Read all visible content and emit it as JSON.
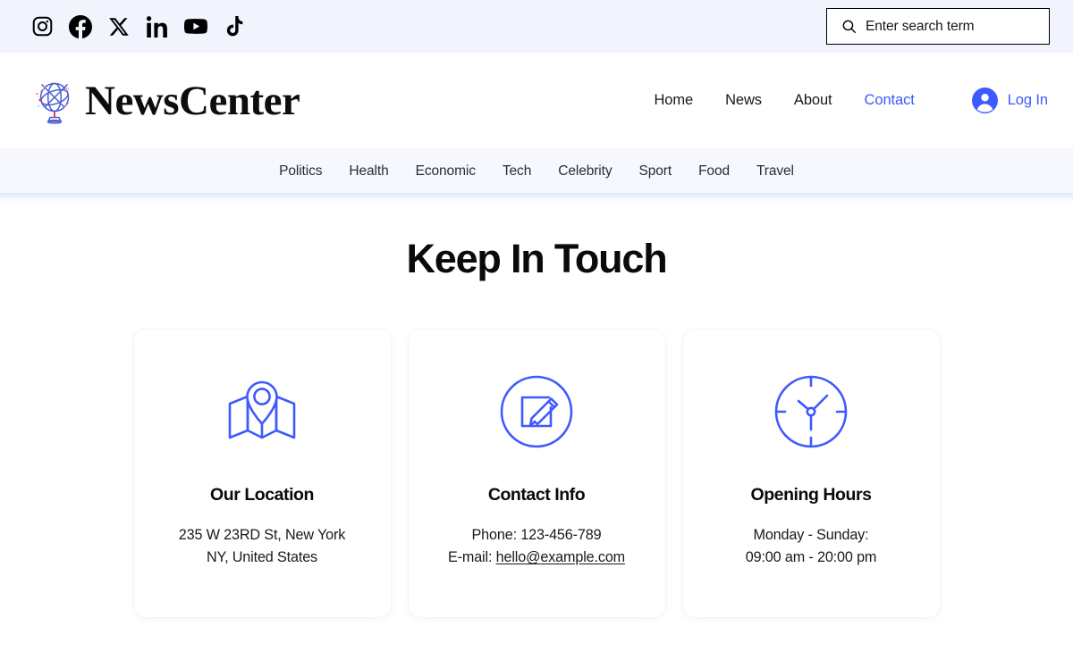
{
  "colors": {
    "accent": "#3d5afe",
    "topbar_bg": "#f1f3fd",
    "catbar_bg": "#f6f8fe",
    "text": "#0a0a0a",
    "page_bg": "#ffffff"
  },
  "topbar": {
    "social": [
      {
        "name": "instagram-icon",
        "label": "Instagram"
      },
      {
        "name": "facebook-icon",
        "label": "Facebook"
      },
      {
        "name": "x-twitter-icon",
        "label": "X"
      },
      {
        "name": "linkedin-icon",
        "label": "LinkedIn"
      },
      {
        "name": "youtube-icon",
        "label": "YouTube"
      },
      {
        "name": "tiktok-icon",
        "label": "TikTok"
      }
    ],
    "search": {
      "icon": "search-icon",
      "placeholder": "Enter search term",
      "value": ""
    }
  },
  "header": {
    "logo_icon": "globe-icon",
    "brand_name": "NewsCenter",
    "nav": [
      {
        "label": "Home",
        "active": false
      },
      {
        "label": "News",
        "active": false
      },
      {
        "label": "About",
        "active": false
      },
      {
        "label": "Contact",
        "active": true
      }
    ],
    "login": {
      "icon": "account-circle-icon",
      "label": "Log In"
    }
  },
  "categories": [
    {
      "label": "Politics"
    },
    {
      "label": "Health"
    },
    {
      "label": "Economic"
    },
    {
      "label": "Tech"
    },
    {
      "label": "Celebrity"
    },
    {
      "label": "Sport"
    },
    {
      "label": "Food"
    },
    {
      "label": "Travel"
    }
  ],
  "main": {
    "title": "Keep In Touch",
    "cards": [
      {
        "icon": "map-pin-icon",
        "title": "Our Location",
        "line1": "235 W 23RD St, New York",
        "line2": "NY, United States"
      },
      {
        "icon": "edit-pencil-circle-icon",
        "title": "Contact Info",
        "line1": "Phone: 123-456-789",
        "line2_prefix": "E-mail: ",
        "line2_link": "hello@example.com"
      },
      {
        "icon": "clock-icon",
        "title": "Opening Hours",
        "line1": "Monday - Sunday:",
        "line2": "09:00 am - 20:00 pm"
      }
    ]
  }
}
